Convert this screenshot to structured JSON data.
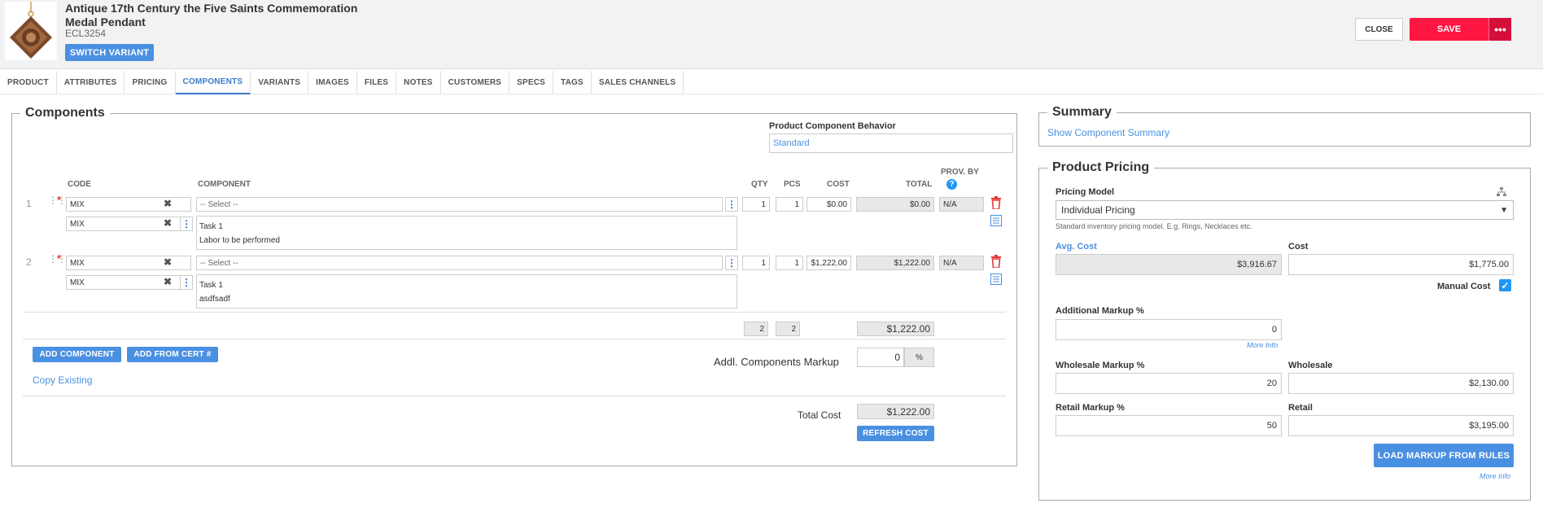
{
  "header": {
    "title": "Antique 17th Century the Five Saints Commemoration Medal Pendant",
    "sku": "ECL3254",
    "switch_label": "SWITCH VARIANT",
    "close_label": "CLOSE",
    "save_label": "SAVE",
    "more_label": "•••"
  },
  "tabs": [
    "PRODUCT",
    "ATTRIBUTES",
    "PRICING",
    "COMPONENTS",
    "VARIANTS",
    "IMAGES",
    "FILES",
    "NOTES",
    "CUSTOMERS",
    "SPECS",
    "TAGS",
    "SALES CHANNELS"
  ],
  "components": {
    "legend": "Components",
    "behavior_label": "Product Component Behavior",
    "behavior_value": "Standard",
    "headers": {
      "code": "CODE",
      "component": "COMPONENT",
      "qty": "QTY",
      "pcs": "PCS",
      "cost": "COST",
      "total": "TOTAL",
      "prov_by": "PROV. BY"
    },
    "rows": [
      {
        "num": "1",
        "code": "MIX",
        "component_placeholder": "-- Select --",
        "qty": "1",
        "pcs": "1",
        "cost": "$0.00",
        "total": "$0.00",
        "prov": "N/A",
        "sub_code": "MIX",
        "task": "Task 1",
        "task_desc": "Labor to be performed"
      },
      {
        "num": "2",
        "code": "MIX",
        "component_placeholder": "-- Select --",
        "qty": "1",
        "pcs": "1",
        "cost": "$1,222.00",
        "total": "$1,222.00",
        "prov": "N/A",
        "sub_code": "MIX",
        "task": "Task 1",
        "task_desc": "asdfsadf"
      }
    ],
    "totals": {
      "qty": "2",
      "pcs": "2",
      "total": "$1,222.00"
    },
    "add_component": "ADD COMPONENT",
    "add_from_cert": "ADD FROM CERT #",
    "copy_existing": "Copy Existing",
    "markup_label": "Addl. Components Markup",
    "markup_value": "0",
    "markup_unit": "%",
    "total_cost_label": "Total Cost",
    "total_cost": "$1,222.00",
    "refresh": "REFRESH COST"
  },
  "summary": {
    "legend": "Summary",
    "link": "Show Component Summary"
  },
  "pricing": {
    "legend": "Product Pricing",
    "model_label": "Pricing Model",
    "model_value": "Individual Pricing",
    "model_hint": "Standard inventory pricing model. E.g. Rings, Necklaces etc.",
    "avg_cost_label": "Avg. Cost",
    "avg_cost": "$3,916.67",
    "cost_label": "Cost",
    "cost": "$1,775.00",
    "manual_cost_label": "Manual Cost",
    "add_markup_label": "Additional Markup %",
    "add_markup": "0",
    "more_info": "More Info",
    "wholesale_markup_label": "Wholesale Markup %",
    "wholesale_markup": "20",
    "wholesale_label": "Wholesale",
    "wholesale": "$2,130.00",
    "retail_markup_label": "Retail Markup %",
    "retail_markup": "50",
    "retail_label": "Retail",
    "retail": "$3,195.00",
    "load_markup": "LOAD MARKUP FROM RULES",
    "more_info2": "More Info"
  },
  "colors": {
    "accent": "#4a90e2",
    "save": "#ff1744",
    "danger": "#e53935"
  }
}
